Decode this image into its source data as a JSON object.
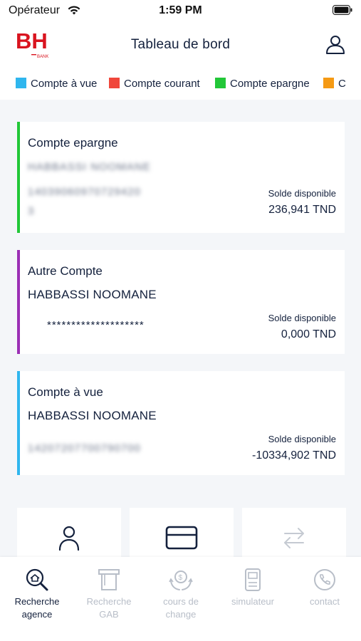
{
  "status_bar": {
    "carrier": "Opérateur",
    "time": "1:59 PM"
  },
  "header": {
    "title": "Tableau de bord",
    "logo_text": "BH",
    "logo_sub": "BANK"
  },
  "legend": [
    {
      "label": "Compte à vue",
      "color": "#2fb6ee"
    },
    {
      "label": "Compte courant",
      "color": "#f0473b"
    },
    {
      "label": "Compte epargne",
      "color": "#22c738"
    },
    {
      "label": "C",
      "color": "#f59a14"
    }
  ],
  "accounts": [
    {
      "type": "Compte epargne",
      "holder_blurred": "HABBASSI NOOMANE",
      "number_blurred_1": "14039060970729420",
      "number_blurred_2": "3",
      "balance_label": "Solde disponible",
      "balance": "236,941 TND",
      "color": "#22c738"
    },
    {
      "type": "Autre Compte",
      "holder": "HABBASSI NOOMANE",
      "masked_number": "********************",
      "balance_label": "Solde disponible",
      "balance": "0,000 TND",
      "color": "#9b2fb5"
    },
    {
      "type": "Compte à vue",
      "holder": "HABBASSI NOOMANE",
      "number_blurred": "14207207700790700",
      "balance_label": "Solde disponible",
      "balance": "-10334,902 TND",
      "color": "#2fb6ee"
    }
  ],
  "quick_actions": [
    {
      "icon": "user-icon"
    },
    {
      "icon": "card-icon"
    },
    {
      "icon": "transfer-icon"
    }
  ],
  "tabs": [
    {
      "label_1": "Recherche",
      "label_2": "agence",
      "icon": "search-agency-icon",
      "active": true
    },
    {
      "label_1": "Recherche",
      "label_2": "GAB",
      "icon": "atm-icon",
      "active": false
    },
    {
      "label_1": "cours de",
      "label_2": "change",
      "icon": "exchange-icon",
      "active": false
    },
    {
      "label_1": "simulateur",
      "label_2": "",
      "icon": "calculator-icon",
      "active": false
    },
    {
      "label_1": "contact",
      "label_2": "",
      "icon": "phone-icon",
      "active": false
    }
  ],
  "colors": {
    "brand_red": "#d9141f",
    "navy": "#14213d",
    "inactive": "#b8bec8"
  }
}
